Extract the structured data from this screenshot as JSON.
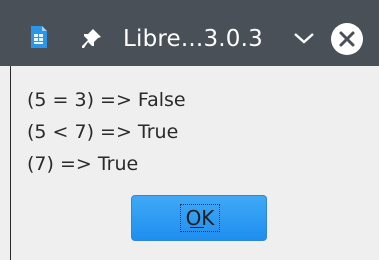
{
  "window": {
    "title": "Libre...3.0.3",
    "app_icon": "document-icon",
    "pin_icon": "pin-icon",
    "menu_icon": "chevron-down-icon",
    "close_icon": "close-icon"
  },
  "message": {
    "lines": [
      "(5 = 3) => False",
      "(5 < 7) => True",
      "(7) => True"
    ]
  },
  "buttons": {
    "ok_label": "OK"
  },
  "colors": {
    "titlebar": "#495058",
    "dialog_background": "#efefef",
    "button_blue": "#2f9ff4",
    "app_icon_blue": "#2a96e8"
  }
}
